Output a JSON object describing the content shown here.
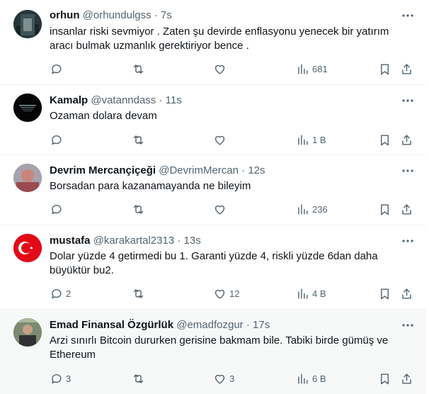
{
  "tweets": [
    {
      "name": "orhun",
      "handle": "@orhundulgss",
      "dot": "·",
      "time": "7s",
      "text": "insanlar riski sevmiyor . Zaten şu devirde enflasyonu yenecek bir yatırım aracı bulmak uzmanlık gerektiriyor bence .",
      "replies": "",
      "retweets": "",
      "likes": "",
      "views": "681",
      "avatar_bg": "#2b3a3e"
    },
    {
      "name": "Kamalp",
      "handle": "@vatanndass",
      "dot": "·",
      "time": "11s",
      "text": "Ozaman dolara devam",
      "replies": "",
      "retweets": "",
      "likes": "",
      "views": "1 B",
      "avatar_bg": "#050505"
    },
    {
      "name": "Devrim Mercançiçeği",
      "handle": "@DevrimMercan",
      "dot": "·",
      "time": "12s",
      "text": "Borsadan para kazanamayanda ne bileyim",
      "replies": "",
      "retweets": "",
      "likes": "",
      "views": "236",
      "avatar_bg": "#b98a8c"
    },
    {
      "name": "mustafa",
      "handle": "@karakartal2313",
      "dot": "·",
      "time": "13s",
      "text": "Dolar yüzde 4 getirmedi bu 1. Garanti yüzde 4, riskli yüzde 6dan daha büyüktür bu2.",
      "replies": "2",
      "retweets": "",
      "likes": "12",
      "views": "4 B",
      "avatar_bg": "#e30a17"
    },
    {
      "name": "Emad Finansal Özgürlük",
      "handle": "@emadfozgur",
      "dot": "·",
      "time": "17s",
      "text": "Arzi sınırlı Bitcoin dururken gerisine bakmam bile. Tabiki birde gümüş ve Ethereum",
      "replies": "3",
      "retweets": "",
      "likes": "3",
      "views": "6 B",
      "avatar_bg": "#5f6b5c"
    }
  ],
  "colors": {
    "text_primary": "#0f1419",
    "text_secondary": "#536471",
    "divider": "#eff3f4",
    "hover_bg": "#f7f9f9"
  },
  "icons": [
    "more-icon",
    "reply-icon",
    "retweet-icon",
    "like-icon",
    "views-icon",
    "bookmark-icon",
    "share-icon"
  ]
}
